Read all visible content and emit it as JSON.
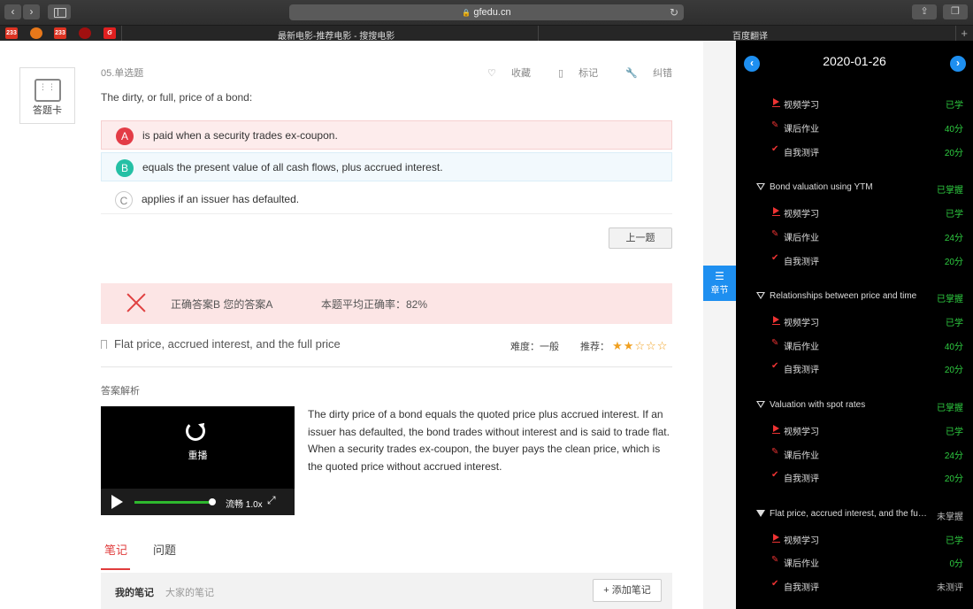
{
  "browser": {
    "url": "gfedu.cn",
    "tabs": [
      "最新电影-推荐电影 - 搜搜电影",
      "百度翻译"
    ],
    "favorites": [
      "233",
      "233"
    ]
  },
  "question": {
    "card_label": "答题卡",
    "meta": "05.单选题",
    "tools": {
      "collect": "收藏",
      "mark": "标记",
      "correct": "纠错"
    },
    "text": "The dirty, or full, price of a bond:",
    "options": [
      {
        "letter": "A",
        "text": "is paid when a security trades ex-coupon."
      },
      {
        "letter": "B",
        "text": "equals the present value of all cash flows, plus accrued interest."
      },
      {
        "letter": "C",
        "text": "applies if an issuer has defaulted."
      }
    ],
    "prev_label": "上一题"
  },
  "result": {
    "answer_text": "正确答案B 您的答案A",
    "accuracy_text": "本题平均正确率：82%"
  },
  "knowledge": {
    "title": "Flat price, accrued interest, and the full price",
    "difficulty_text": "难度：一般",
    "recommend_label": "推荐：",
    "stars": 2,
    "stars_max": 5
  },
  "analysis": {
    "title": "答案解析",
    "text": "The dirty price of a bond equals the quoted price plus accrued interest. If an issuer has defaulted, the bond trades without interest and is said to trade flat. When a security trades ex-coupon, the buyer pays the clean price, which is the quoted price without accrued interest.",
    "video": {
      "replay_label": "重播",
      "quality_label": "流畅 1.0x",
      "progress": 1.0
    }
  },
  "notes": {
    "tab_notes": "笔记",
    "tab_questions": "问题",
    "mine": "我的笔记",
    "all": "大家的笔记",
    "add": "+ 添加笔记"
  },
  "chapter_tab": "章节",
  "panel": {
    "date": "2020-01-26",
    "rows": [
      {
        "kind": "item",
        "icon": "play",
        "name": "视频学习",
        "status": "已学"
      },
      {
        "kind": "item",
        "icon": "pen",
        "name": "课后作业",
        "status": "40分"
      },
      {
        "kind": "item",
        "icon": "check",
        "name": "自我测评",
        "status": "20分"
      },
      {
        "kind": "head",
        "name": "Bond valuation using YTM",
        "status": "已掌握"
      },
      {
        "kind": "item",
        "icon": "play",
        "name": "视频学习",
        "status": "已学"
      },
      {
        "kind": "item",
        "icon": "pen",
        "name": "课后作业",
        "status": "24分"
      },
      {
        "kind": "item",
        "icon": "check",
        "name": "自我测评",
        "status": "20分"
      },
      {
        "kind": "head",
        "name": "Relationships between price and time",
        "status": "已掌握"
      },
      {
        "kind": "item",
        "icon": "play",
        "name": "视频学习",
        "status": "已学"
      },
      {
        "kind": "item",
        "icon": "pen",
        "name": "课后作业",
        "status": "40分"
      },
      {
        "kind": "item",
        "icon": "check",
        "name": "自我测评",
        "status": "20分"
      },
      {
        "kind": "head",
        "name": "Valuation with spot rates",
        "status": "已掌握"
      },
      {
        "kind": "item",
        "icon": "play",
        "name": "视频学习",
        "status": "已学"
      },
      {
        "kind": "item",
        "icon": "pen",
        "name": "课后作业",
        "status": "24分"
      },
      {
        "kind": "item",
        "icon": "check",
        "name": "自我测评",
        "status": "20分"
      },
      {
        "kind": "head",
        "name": "Flat price, accrued interest, and the full price",
        "status": "未掌握",
        "active": true
      },
      {
        "kind": "item",
        "icon": "play",
        "name": "视频学习",
        "status": "已学"
      },
      {
        "kind": "item",
        "icon": "pen",
        "name": "课后作业",
        "status": "0分"
      },
      {
        "kind": "item",
        "icon": "check",
        "name": "自我测评",
        "status": "未测评",
        "gray": true
      }
    ]
  }
}
